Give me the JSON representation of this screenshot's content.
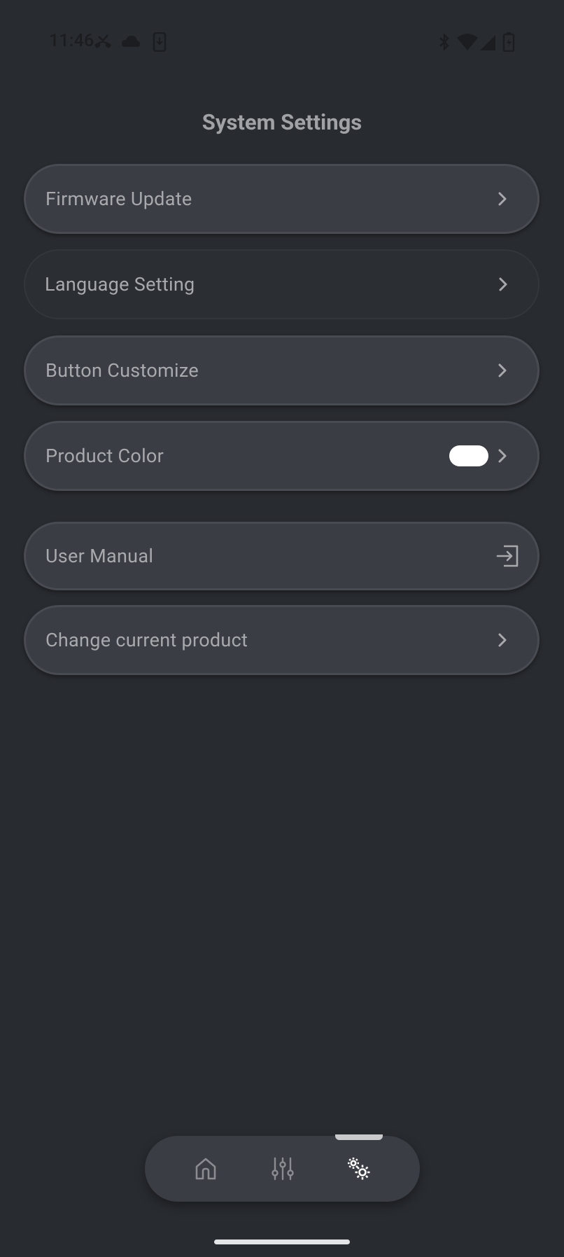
{
  "status_bar": {
    "time": "11:46"
  },
  "page": {
    "title": "System Settings"
  },
  "settings_items": [
    {
      "label": "Firmware Update"
    },
    {
      "label": "Language Setting"
    },
    {
      "label": "Button Customize"
    },
    {
      "label": "Product Color"
    },
    {
      "label": "User Manual"
    },
    {
      "label": "Change current product"
    }
  ],
  "product_color": {
    "swatch_color": "#ffffff"
  },
  "bottom_nav": {
    "items": [
      {
        "icon": "home-icon",
        "active": false
      },
      {
        "icon": "equalizer-icon",
        "active": false
      },
      {
        "icon": "settings-gears-icon",
        "active": true
      }
    ]
  },
  "colors": {
    "background": "#282b30",
    "row_background": "#3a3d43",
    "text": "#a7a9ad",
    "active_icon": "#ffffff"
  }
}
